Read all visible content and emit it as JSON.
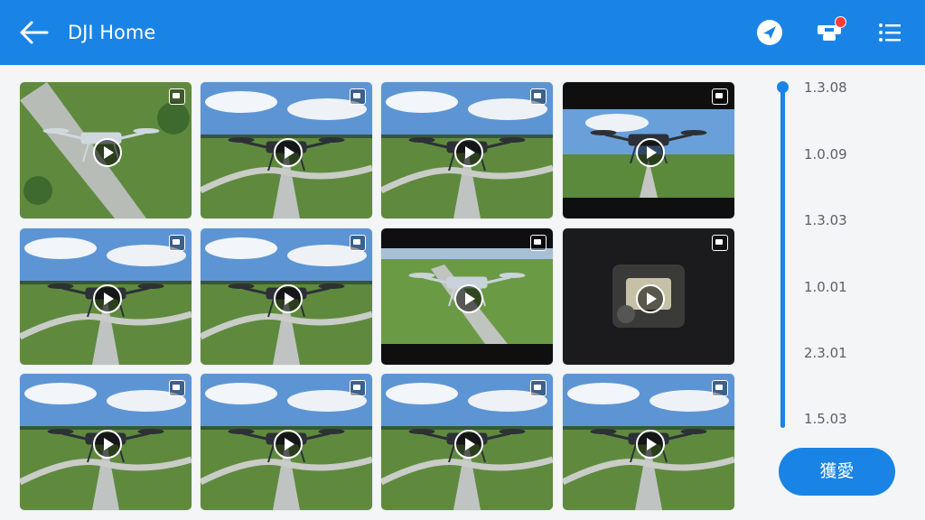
{
  "header": {
    "title": "DJI Home",
    "icons": [
      "back-arrow-icon",
      "send-icon",
      "drone-notification-icon",
      "list-menu-icon"
    ],
    "accent_color": "#1a84e6"
  },
  "gallery": {
    "items": [
      {
        "kind": "aerial-top"
      },
      {
        "kind": "sky"
      },
      {
        "kind": "sky"
      },
      {
        "kind": "letterbox"
      },
      {
        "kind": "sky"
      },
      {
        "kind": "sky"
      },
      {
        "kind": "letterbox-aerial"
      },
      {
        "kind": "dark"
      },
      {
        "kind": "sky"
      },
      {
        "kind": "sky"
      },
      {
        "kind": "sky"
      },
      {
        "kind": "sky"
      }
    ]
  },
  "timeline": {
    "versions": [
      "1.3.08",
      "1.0.09",
      "1.3.03",
      "1.0.01",
      "2.3.01",
      "1.5.03"
    ]
  },
  "action_button": {
    "label": "獲愛"
  }
}
